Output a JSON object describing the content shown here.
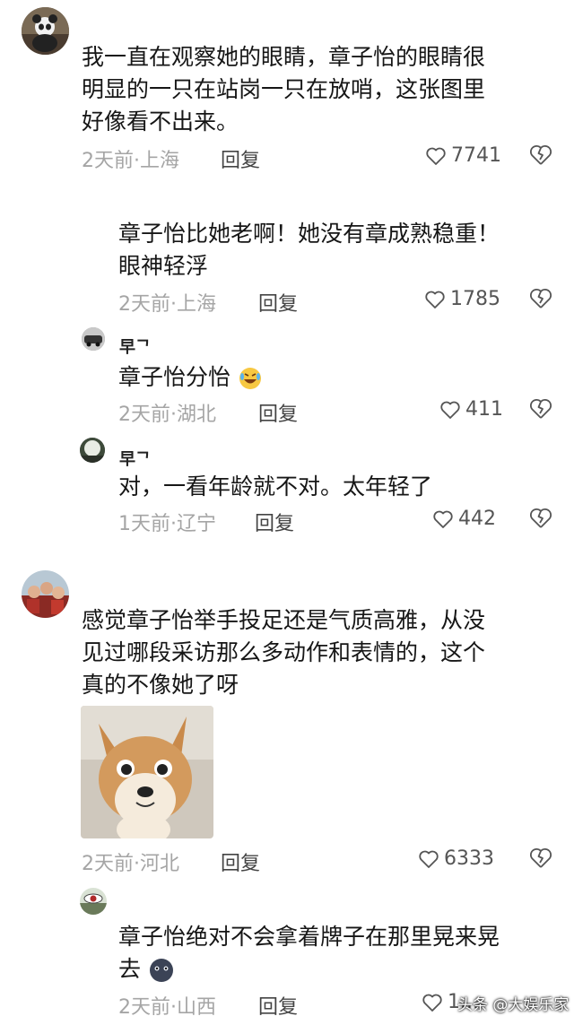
{
  "comments": [
    {
      "text_lines": [
        "我一直在观察她的眼睛，章子怡的眼睛很",
        "明显的一只在站岗一只在放哨，这张图里",
        "好像看不出来。"
      ],
      "meta": "2天前·上海",
      "reply": "回复",
      "likes": "7741",
      "replies": [
        {
          "text_lines": [
            "章子怡比她老啊！她没有章成熟稳重！",
            "眼神轻浮"
          ],
          "meta": "2天前·上海",
          "reply": "回复",
          "likes": "1785"
        },
        {
          "username": "早ᄀ",
          "text": "章子怡分怡",
          "emoji": "laughing-crying-emoji",
          "meta": "2天前·湖北",
          "reply": "回复",
          "likes": "411"
        },
        {
          "username": "早ᄀ",
          "text": "对，一看年龄就不对。太年轻了",
          "meta": "1天前·辽宁",
          "reply": "回复",
          "likes": "442"
        }
      ]
    },
    {
      "text_lines": [
        "感觉章子怡举手投足还是气质高雅，从没",
        "见过哪段采访那么多动作和表情的，这个",
        "真的不像她了呀"
      ],
      "image": "shiba-dog-meme",
      "meta": "2天前·河北",
      "reply": "回复",
      "likes": "6333",
      "replies": [
        {
          "text_lines": [
            "章子怡绝对不会拿着牌子在那里晃来晃",
            "去"
          ],
          "emoji": "blob-emoji",
          "meta": "2天前·山西",
          "reply": "回复",
          "likes": "1..."
        }
      ]
    }
  ],
  "watermark": "头条 @大娱乐家",
  "colors": {
    "meta": "#a5a5a5",
    "text": "#161616",
    "icon": "#555555"
  }
}
